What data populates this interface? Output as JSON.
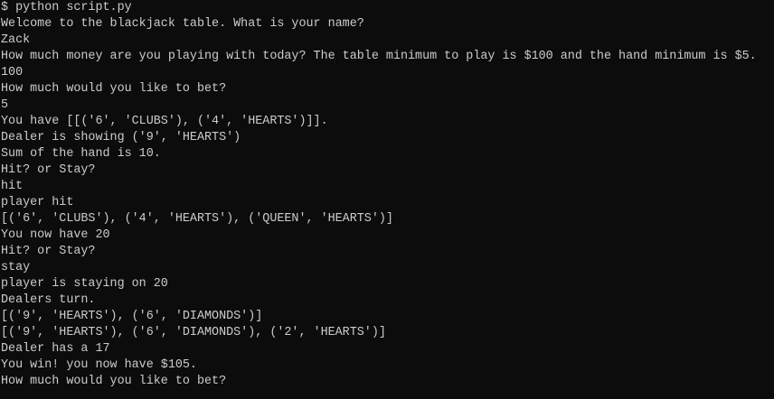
{
  "terminal": {
    "lines": [
      "$ python script.py",
      "Welcome to the blackjack table. What is your name?",
      "Zack",
      "How much money are you playing with today? The table minimum to play is $100 and the hand minimum is $5.",
      "100",
      "How much would you like to bet?",
      "5",
      "You have [[('6', 'CLUBS'), ('4', 'HEARTS')]].",
      "Dealer is showing ('9', 'HEARTS')",
      "Sum of the hand is 10.",
      "Hit? or Stay?",
      "hit",
      "player hit",
      "[('6', 'CLUBS'), ('4', 'HEARTS'), ('QUEEN', 'HEARTS')]",
      "You now have 20",
      "Hit? or Stay?",
      "stay",
      "player is staying on 20",
      "Dealers turn.",
      "[('9', 'HEARTS'), ('6', 'DIAMONDS')]",
      "[('9', 'HEARTS'), ('6', 'DIAMONDS'), ('2', 'HEARTS')]",
      "Dealer has a 17",
      "You win! you now have $105.",
      "How much would you like to bet?"
    ]
  }
}
